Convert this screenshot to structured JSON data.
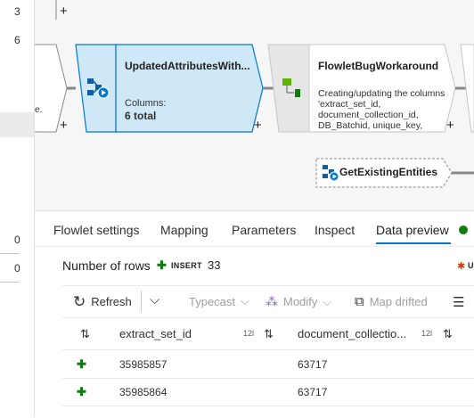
{
  "gutter": {
    "numbers": [
      "3",
      "6",
      "0",
      "0"
    ]
  },
  "canvas": {
    "left_node_fragment": "e.",
    "node1": {
      "title": "UpdatedAttributesWith...",
      "columns_label": "Columns:",
      "columns_value": "6 total"
    },
    "node2": {
      "title": "FlowletBugWorkaround",
      "description_lines": [
        "Creating/updating the columns",
        "'extract_set_id,",
        "document_collection_id,",
        "DB_Batchid, unique_key,"
      ]
    },
    "node3": {
      "title": "GetExistingEntities"
    },
    "add_symbol": "+"
  },
  "tabs": [
    {
      "label": "Flowlet settings"
    },
    {
      "label": "Mapping"
    },
    {
      "label": "Parameters"
    },
    {
      "label": "Inspect"
    },
    {
      "label": "Data preview"
    }
  ],
  "active_tab": "Data preview",
  "status_dot_color": "#107c10",
  "rows_bar": {
    "label": "Number of rows",
    "insert_label": "INSERT",
    "insert_count": "33",
    "update_fragment": "U"
  },
  "toolbar": {
    "refresh": "Refresh",
    "typecast": "Typecast",
    "modify": "Modify",
    "map_drifted": "Map drifted"
  },
  "table": {
    "type_badge": "12l",
    "columns": [
      "extract_set_id",
      "document_collectio..."
    ],
    "rows": [
      {
        "extract_set_id": "35985857",
        "document_collection_id": "63717"
      },
      {
        "extract_set_id": "35985864",
        "document_collection_id": "63717"
      }
    ]
  }
}
